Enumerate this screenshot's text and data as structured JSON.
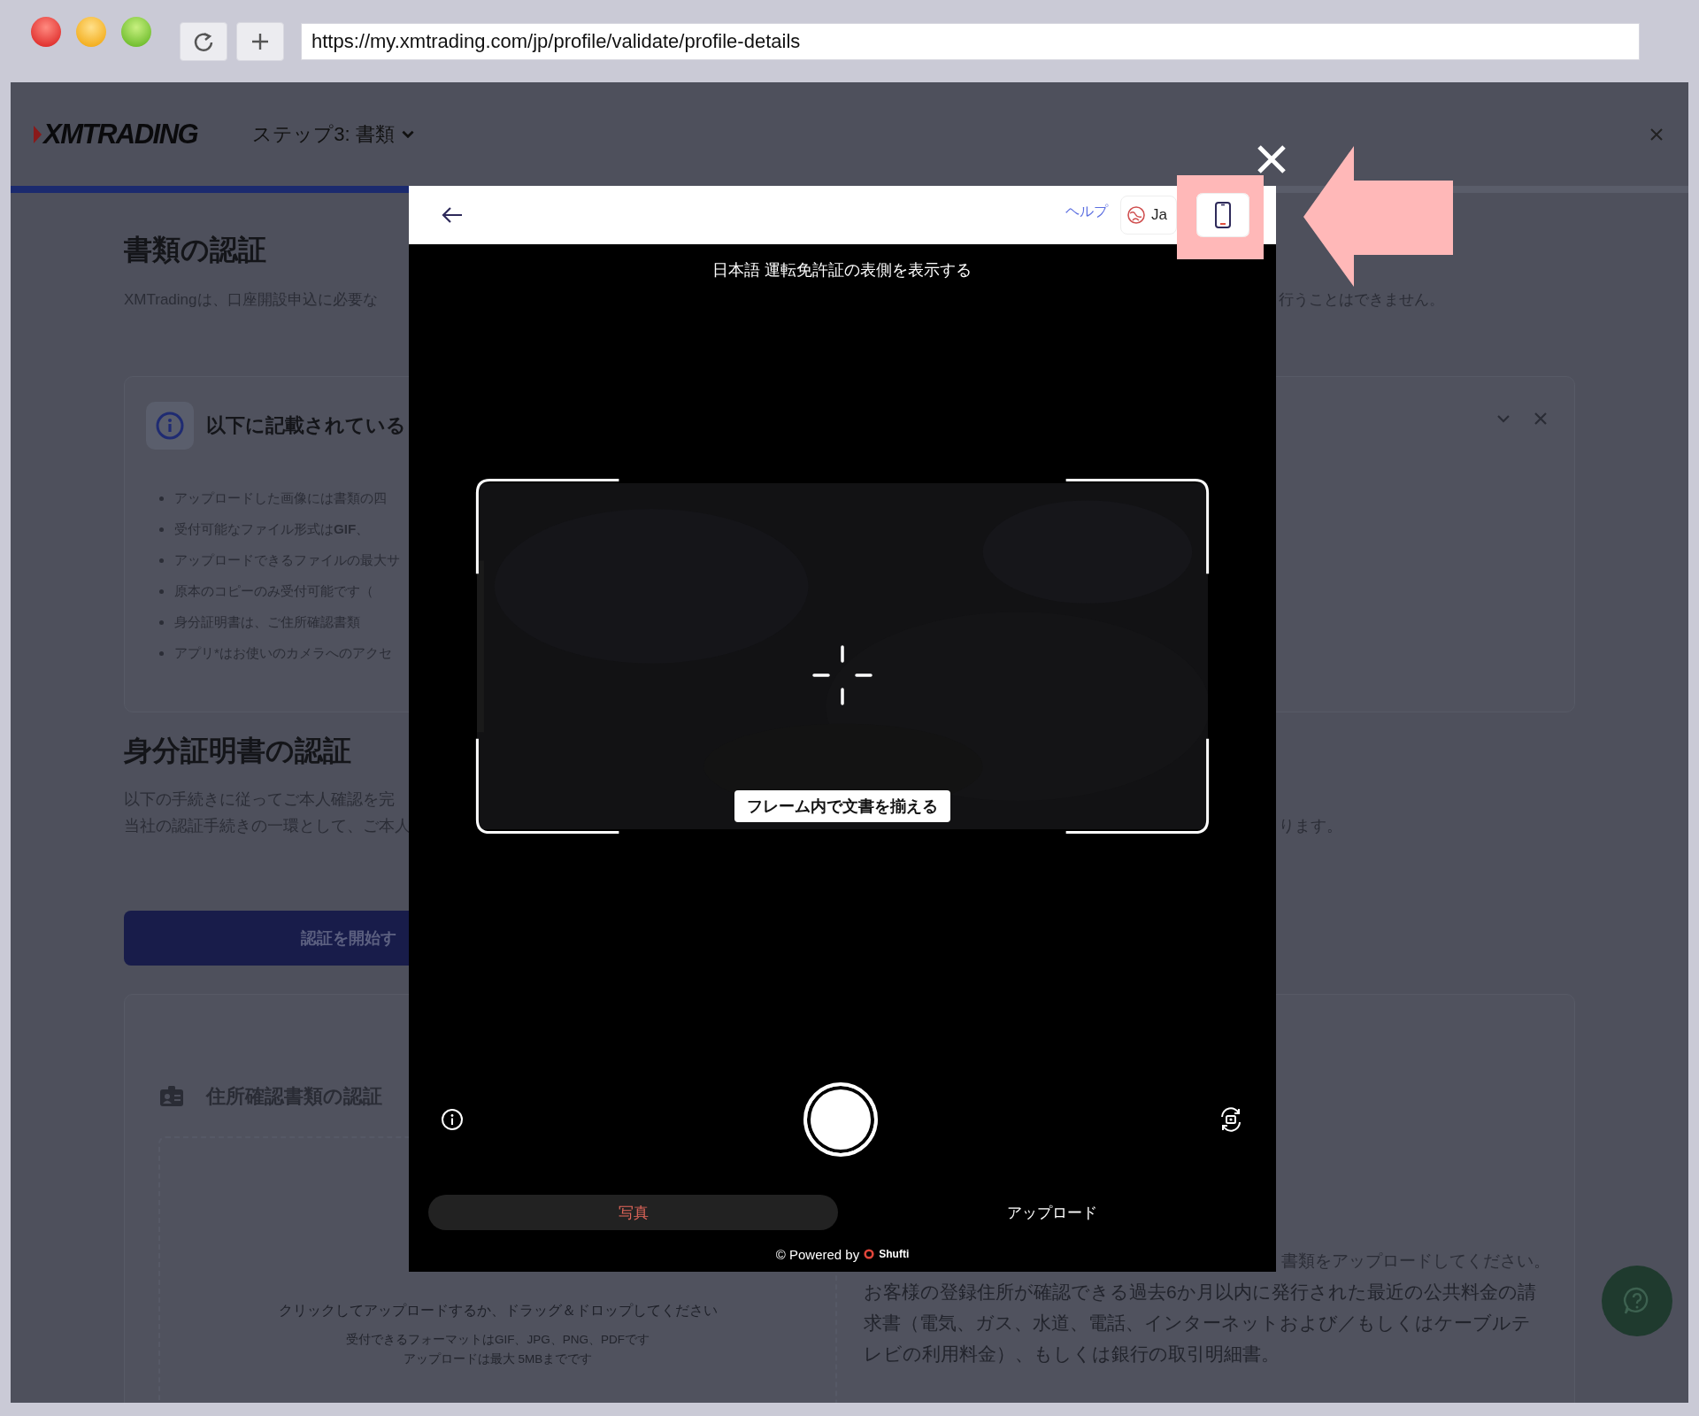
{
  "browser": {
    "url": "https://my.xmtrading.com/jp/profile/validate/profile-details"
  },
  "header": {
    "logo": "XMTRADING",
    "step": "ステップ3: 書類",
    "progress": {
      "level": 0.24
    }
  },
  "documents": {
    "title": "書類の認証",
    "description": "XMTradingは、口座開設申込に必要な",
    "tail": "行うことはできません。"
  },
  "notice": {
    "title": "以下に記載されている",
    "bullets": [
      {
        "text": "アップロードした画像には書類の四"
      },
      {
        "text": "受付可能なファイル形式は**GIF**、"
      },
      {
        "text": "アップロードできるファイルの最大サ"
      },
      {
        "text": "原本のコピーのみ受付可能です（"
      },
      {
        "text": "身分証明書は、ご住所確認書類"
      },
      {
        "text": "アプリ*はお使いのカメラへのアクセ"
      }
    ]
  },
  "identity": {
    "title": "身分証明書の認証",
    "lines": [
      {
        "text": "以下の手続きに従ってご本人確認を完"
      },
      {
        "text": "当社の認証手続きの一環として、ご本人",
        "tail": "ります。"
      }
    ],
    "start_button": "認証を開始す"
  },
  "address": {
    "title": "住所確認書類の認証",
    "dropzone": {
      "prompt": "クリックしてアップロードするか、ドラッグ＆ドロップしてください",
      "formats": "受付できるフォーマットはGIF、JPG、PNG、PDFです",
      "limit": "アップロードは最大 5MBまでです"
    },
    "tail": "書類をアップロードしてください。",
    "description": "お客様の登録住所が確認できる過去6か月以内に発行された最近の公共料金の請求書（電気、ガス、水道、電話、インターネットおよび／もしくはケーブルテレビの利用料金）、もしくは銀行の取引明細書。"
  },
  "modal": {
    "title": "日本語 運転免許証の表側を表示する",
    "help": "ヘルプ",
    "language": "Ja",
    "frame_hint": "フレーム内で文書を揃える",
    "tabs": [
      {
        "label": "写真",
        "selected": true
      },
      {
        "label": "アップロード",
        "selected": false
      }
    ],
    "powered_by": "© Powered by",
    "brand": "Shufti"
  }
}
